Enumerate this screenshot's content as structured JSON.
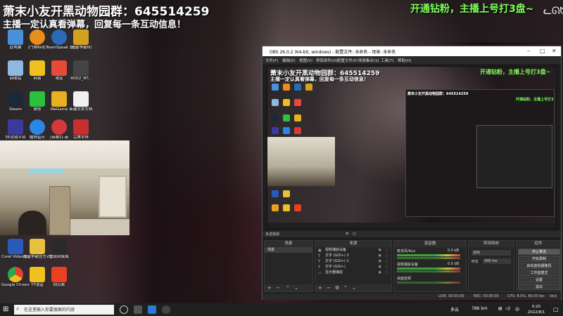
{
  "overlay": {
    "title": "萧末小友开黑动物园群：645514259",
    "subtitle": "主播一定认真看弹幕，回复每一条互动信息！",
    "right_text": "开通钻粉，主播上号打3盘~"
  },
  "desktop": {
    "icons": [
      {
        "label": "此电脑",
        "color": "#4a90d9"
      },
      {
        "label": "(鬥陣特攻)",
        "color": "#e88c1c"
      },
      {
        "label": "TeamSpeak 3",
        "color": "#2a6ab8"
      },
      {
        "label": "(魔獸爭霸III)",
        "color": "#d4a020"
      },
      {
        "label": "回收站",
        "color": "#8fb8e0"
      },
      {
        "label": "网易",
        "color": "#f0c020"
      },
      {
        "label": "淘宝",
        "color": "#e84a3a"
      },
      {
        "label": "XOD2_NT...",
        "color": "#444444"
      },
      {
        "label": "Steam",
        "color": "#1b2838"
      },
      {
        "label": "微信",
        "color": "#2ac13e"
      },
      {
        "label": "WeGame",
        "color": "#e8b020"
      },
      {
        "label": "新建文本文档",
        "color": "#f0f0f0"
      },
      {
        "label": "5E对战平台",
        "color": "#3a3a9a"
      },
      {
        "label": "酷狗音乐",
        "color": "#2a86e8"
      },
      {
        "label": "(英雄2)-英",
        "color": "#d43a3a"
      },
      {
        "label": "完美世界",
        "color": "#c83030"
      }
    ],
    "bottom_icons": [
      {
        "label": "Corel VideoStudi...",
        "color": "#2a5ab8"
      },
      {
        "label": "魔兽争霸官方对战平台",
        "color": "#e8c040"
      },
      {
        "label": "重启到桌面",
        "color": "#2a2a2a"
      },
      {
        "label": "Google Chrome",
        "color": "#e8a020"
      },
      {
        "label": "YY语音",
        "color": "#f0c020"
      },
      {
        "label": "向日葵",
        "color": "#e84020"
      }
    ]
  },
  "obs": {
    "window_title": "OBS 26.0.2 (64-bit, windows) - 配置文件: 未命名 - 场景: 未命名",
    "menu": [
      "文件(F)",
      "编辑(E)",
      "视图(V)",
      "停靠部件(D)",
      "配置文件(P)",
      "场景集合(S)",
      "工具(T)",
      "帮助(H)"
    ],
    "no_source": "未选择源",
    "panels": {
      "scenes": {
        "title": "场景",
        "items": [
          "场景"
        ]
      },
      "sources": {
        "title": "来源",
        "items": [
          "视频捕获设备",
          "文字 (GDI+) 3",
          "文字 (GDI+) 2",
          "文字 (GDI+)",
          "显示器捕获"
        ]
      },
      "mixer": {
        "title": "混音器",
        "channels": [
          {
            "name": "麦克风/Aux",
            "db": "0.0 dB"
          },
          {
            "name": "视频捕获设备",
            "db": "0.0 dB"
          },
          {
            "name": "桌面音频",
            "db": ""
          }
        ]
      },
      "transitions": {
        "title": "转场特效",
        "type": "淡出",
        "duration_label": "时长",
        "duration_value": "300 ms"
      },
      "controls": {
        "title": "控件",
        "buttons": [
          "停止推流",
          "开始录制",
          "启动虚拟摄像机",
          "工作室模式",
          "设置",
          "退出"
        ]
      }
    },
    "status": {
      "live": "LIVE: 00:00:00",
      "rec": "REC: 00:00:00",
      "cpu": "CPU: 8.5%, 60.00 fps",
      "kbps": "kb/s"
    }
  },
  "taskbar": {
    "search_placeholder": "在这里输入你要搜索的内容",
    "tray_weather": "多云",
    "tray_speed": "786 km",
    "tray_lang": "中",
    "time": "0:20",
    "date": "2022/8/1"
  }
}
